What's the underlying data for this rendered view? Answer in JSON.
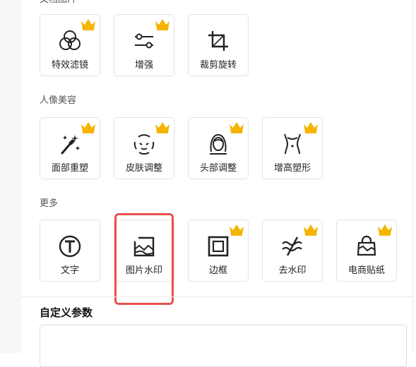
{
  "sections": {
    "image_optimize": "文档图片",
    "portrait": "人像美容",
    "more": "更多"
  },
  "tools": {
    "filter": "特效滤镜",
    "enhance": "增强",
    "crop_rotate": "裁剪旋转",
    "face_reshape": "面部重塑",
    "skin_adjust": "皮肤调整",
    "head_adjust": "头部调整",
    "height_shape": "增高塑形",
    "text": "文字",
    "image_watermark": "图片水印",
    "border": "边框",
    "remove_watermark": "去水印",
    "ecommerce_sticker": "电商贴纸"
  },
  "custom_params": {
    "title": "自定义参数"
  },
  "colors": {
    "crown": "#f5b400",
    "highlight": "#e85050",
    "icon": "#222222"
  }
}
